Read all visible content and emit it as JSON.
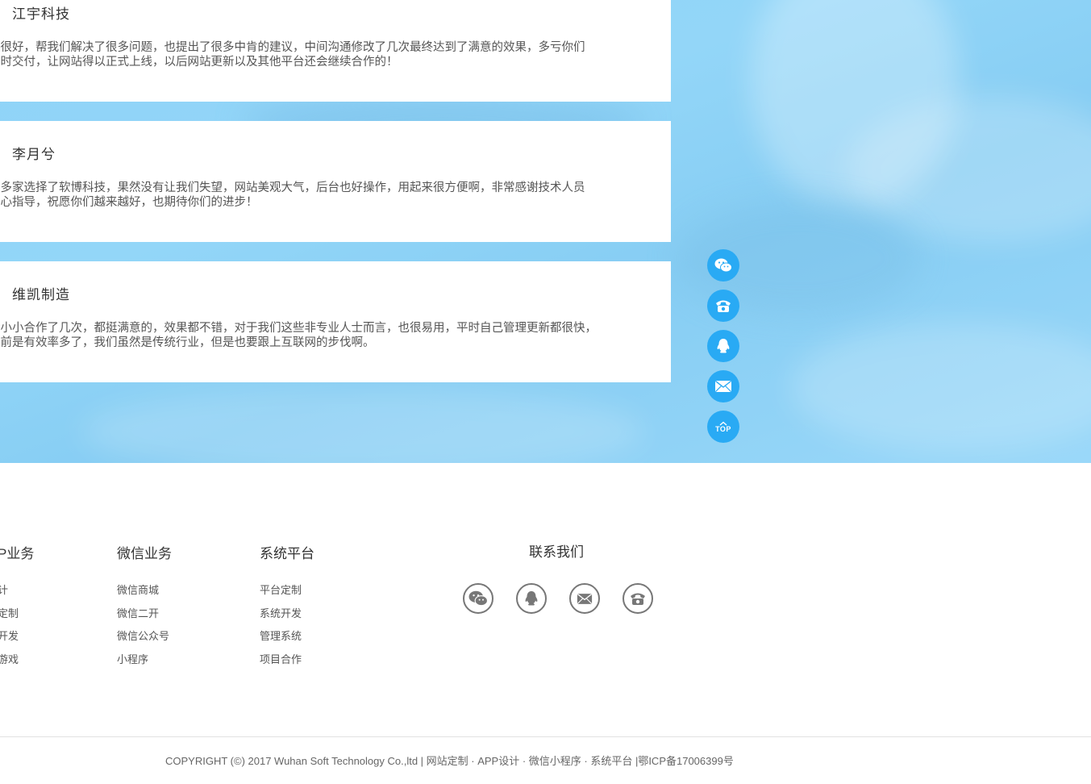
{
  "testimonials": [
    {
      "name": "江宇科技",
      "text": "务很好，帮我们解决了很多问题，也提出了很多中肯的建议，中间沟通修改了几次最终达到了满意的效果，多亏你们\n设时交付，让网站得以正式上线，以后网站更新以及其他平台还会继续合作的！"
    },
    {
      "name": "李月兮",
      "text": "七多家选择了软博科技，果然没有让我们失望，网站美观大气，后台也好操作，用起来很方便啊，非常感谢技术人员\n耐心指导，祝愿你们越来越好，也期待你们的进步！"
    },
    {
      "name": "维凯制造",
      "text": "大小小合作了几次，都挺满意的，效果都不错，对于我们这些非专业人士而言，也很易用，平时自己管理更新都很快，\n以前是有效率多了，我们虽然是传统行业，但是也要跟上互联网的步伐啊。"
    }
  ],
  "side_tools": {
    "items": [
      "wechat-icon",
      "phone-icon",
      "qq-icon",
      "mail-icon"
    ],
    "top_label": "TOP"
  },
  "footer": {
    "columns": [
      {
        "title": "P业务",
        "items": [
          "计",
          "定制",
          "开发",
          "游戏"
        ]
      },
      {
        "title": "微信业务",
        "items": [
          "微信商城",
          "微信二开",
          "微信公众号",
          "小程序"
        ]
      },
      {
        "title": "系统平台",
        "items": [
          "平台定制",
          "系统开发",
          "管理系统",
          "项目合作"
        ]
      }
    ],
    "contact": {
      "title": "联系我们",
      "icons": [
        "wechat-icon",
        "qq-icon",
        "mail-icon",
        "phone-icon"
      ]
    },
    "copyright": "COPYRIGHT (©) 2017 Wuhan Soft Technology Co.,ltd | 网站定制 · APP设计 · 微信小程序 · 系统平台 |鄂ICP备17006399号"
  },
  "colors": {
    "accent": "#29aaf4",
    "hero_bg": "#93d6f8"
  }
}
